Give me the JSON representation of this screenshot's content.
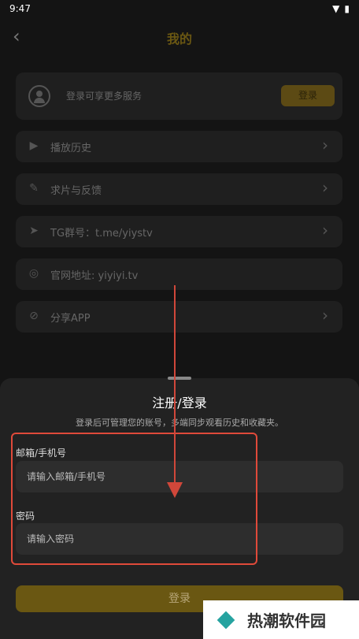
{
  "status": {
    "time": "9:47"
  },
  "header": {
    "title": "我的"
  },
  "profile": {
    "prompt": "登录可享更多服务",
    "login_label": "登录"
  },
  "menu": [
    {
      "label": "播放历史",
      "icon": "play-history-icon"
    },
    {
      "label": "求片与反馈",
      "icon": "edit-icon"
    },
    {
      "label": "TG群号：t.me/yiystv",
      "icon": "telegram-icon"
    },
    {
      "label": "官网地址: yiyiyi.tv",
      "icon": "globe-icon"
    },
    {
      "label": "分享APP",
      "icon": "share-icon"
    }
  ],
  "sheet": {
    "title": "注册/登录",
    "subtitle": "登录后可管理您的账号，多端同步观看历史和收藏夹。",
    "email_label": "邮箱/手机号",
    "email_placeholder": "请输入邮箱/手机号",
    "password_label": "密码",
    "password_placeholder": "请输入密码",
    "login_label": "登录"
  },
  "watermark": {
    "text": "热潮软件园"
  }
}
